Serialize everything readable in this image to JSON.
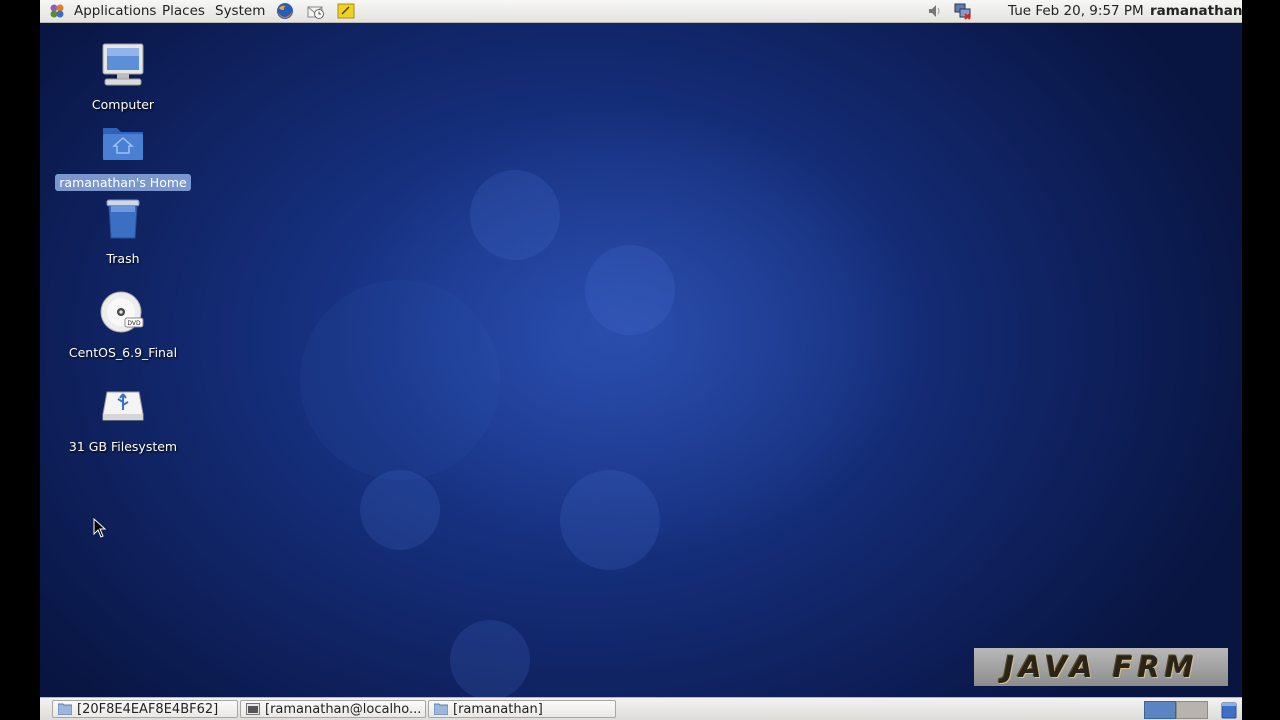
{
  "top_panel": {
    "menus": [
      "Applications",
      "Places",
      "System"
    ],
    "clock": "Tue Feb 20,  9:57 PM",
    "user": "ramanathan"
  },
  "desktop": {
    "icons": [
      {
        "label": "Computer",
        "icon": "computer-icon"
      },
      {
        "label": "ramanathan's Home",
        "icon": "home-folder-icon",
        "selected": true
      },
      {
        "label": "Trash",
        "icon": "trash-icon"
      },
      {
        "label": "CentOS_6.9_Final",
        "icon": "dvd-icon"
      },
      {
        "label": "31 GB Filesystem",
        "icon": "usb-drive-icon"
      }
    ]
  },
  "taskbar": {
    "tasks": [
      {
        "label": "[20F8E4EAF8E4BF62]",
        "icon": "folder-icon"
      },
      {
        "label": "[ramanathan@localho...",
        "icon": "terminal-icon"
      },
      {
        "label": "[ramanathan]",
        "icon": "folder-icon"
      }
    ]
  },
  "watermark": {
    "text": "JAVA FRM"
  },
  "colors": {
    "desktop": "#16307e",
    "selection": "#7a98cf",
    "panel": "#ecebe8"
  }
}
